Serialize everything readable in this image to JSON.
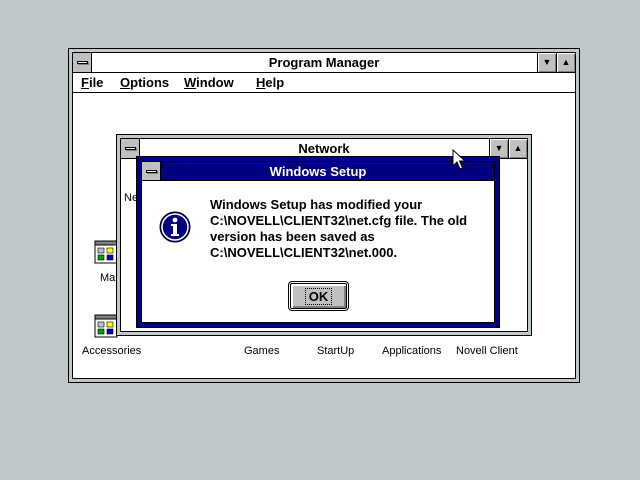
{
  "desktop": {
    "background": "#c0c7c8"
  },
  "program_manager": {
    "title": "Program Manager",
    "menu": [
      {
        "label": "File",
        "mnemonic_underline": "F",
        "rest": "ile"
      },
      {
        "label": "Options",
        "mnemonic_underline": "O",
        "rest": "ptions"
      },
      {
        "label": "Window",
        "mnemonic_underline": "W",
        "rest": "indow"
      },
      {
        "label": "Help",
        "mnemonic_underline": "H",
        "rest": "elp"
      }
    ],
    "groups": [
      {
        "label": "Accessories",
        "icon": "program-group-icon"
      },
      {
        "label": "Games",
        "icon": "program-group-icon"
      },
      {
        "label": "StartUp",
        "icon": "program-group-icon"
      },
      {
        "label": "Applications",
        "icon": "program-group-icon"
      },
      {
        "label": "Novell Client",
        "icon": "program-group-icon"
      }
    ],
    "partial_labels": {
      "main": "Mai"
    }
  },
  "network_window": {
    "title": "Network",
    "partial_label": "Ne"
  },
  "dialog": {
    "title": "Windows Setup",
    "icon": "information-icon",
    "message_lines": [
      "Windows Setup has modified your",
      "C:\\NOVELL\\CLIENT32\\net.cfg file. The old",
      "version has been saved as",
      "C:\\NOVELL\\CLIENT32\\net.000."
    ],
    "ok_label": "OK"
  },
  "colors": {
    "dialog_title": "#000080",
    "button_face": "#c0c0c0"
  }
}
